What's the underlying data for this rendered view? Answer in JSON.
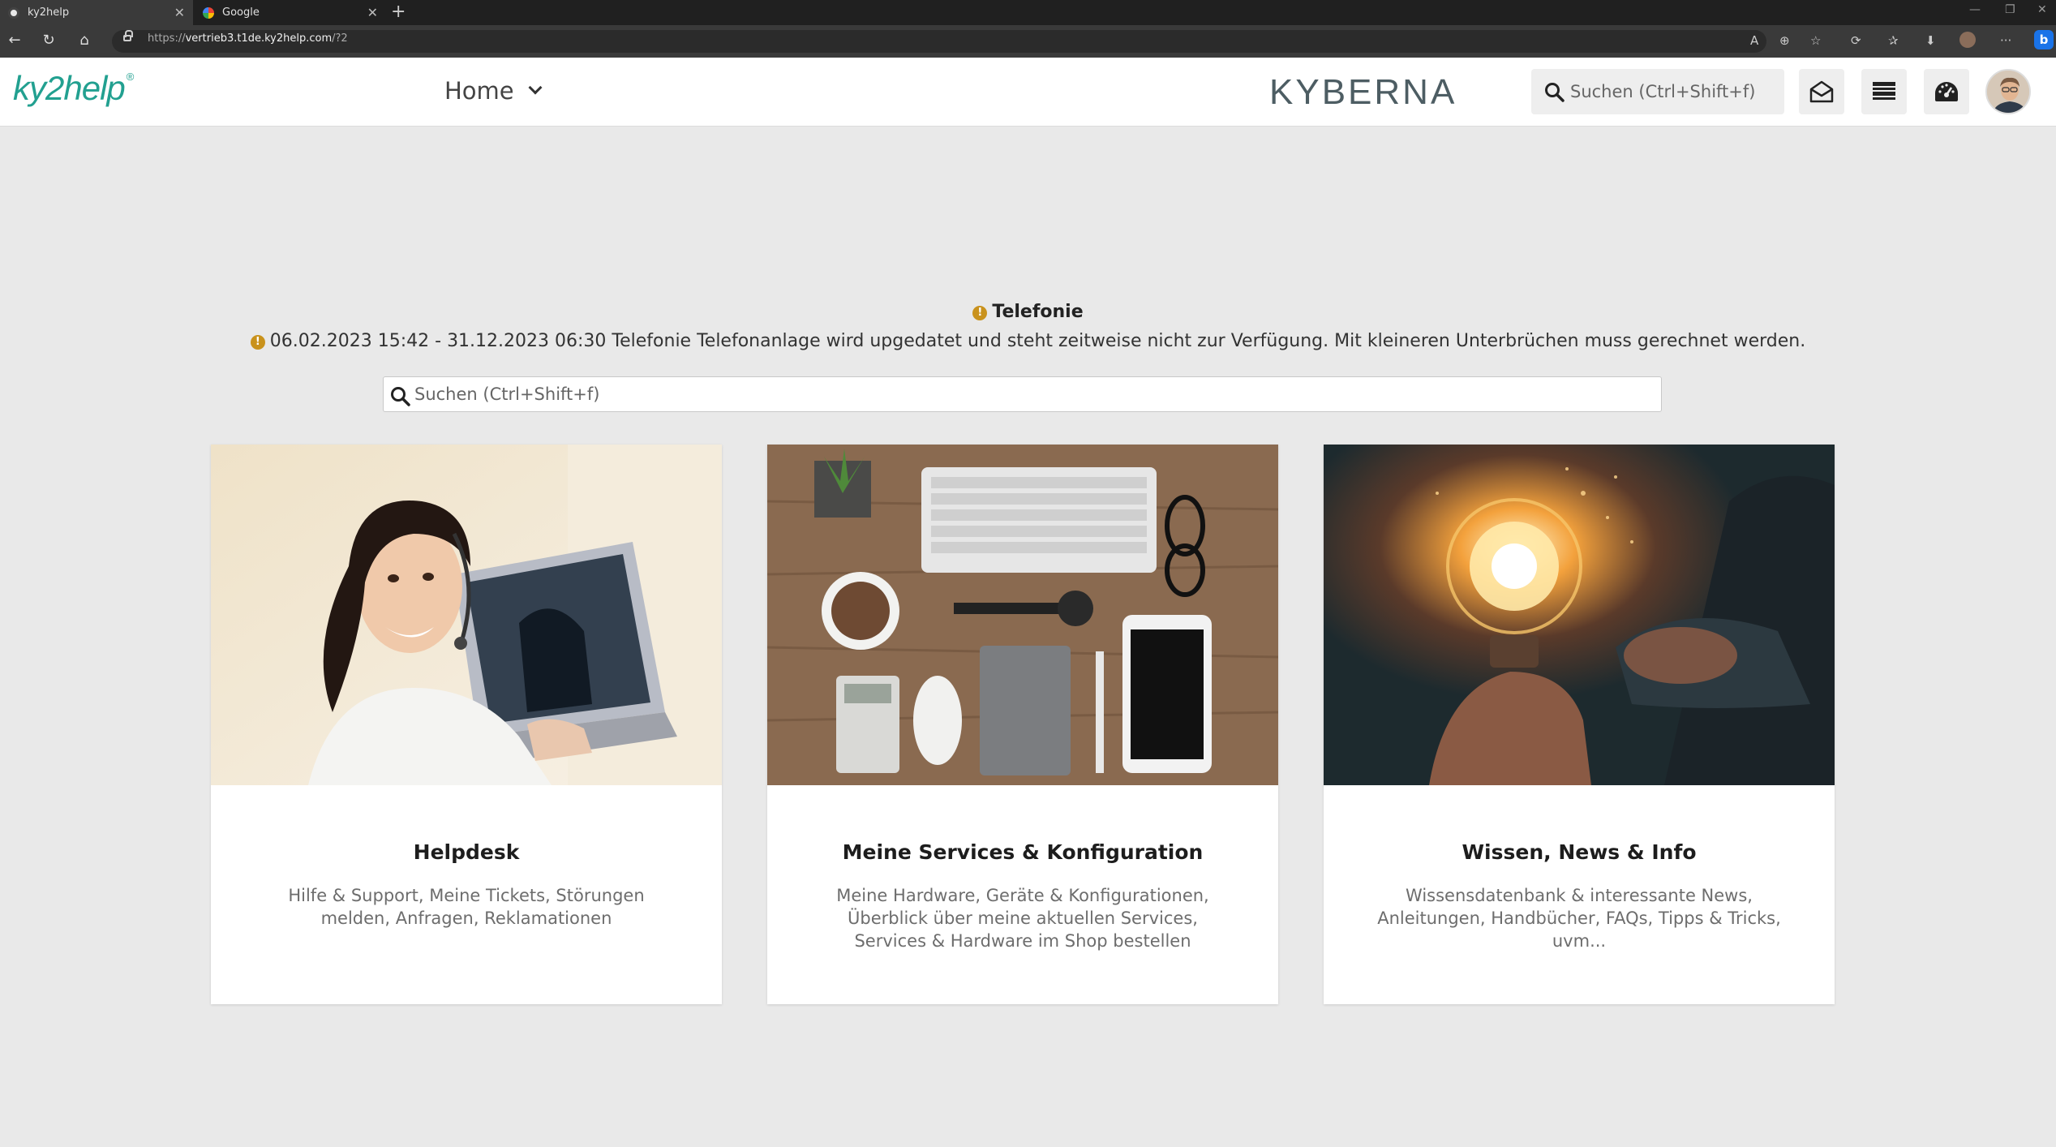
{
  "browser": {
    "tabs": [
      {
        "title": "ky2help"
      },
      {
        "title": "Google"
      }
    ],
    "url_prefix": "https://",
    "url_host": "vertrieb3.t1de.ky2help.com",
    "url_path": "/?2"
  },
  "header": {
    "logo_text": "ky2help",
    "logo_mark": "®",
    "nav_label": "Home",
    "brand_text": "KYBERNA",
    "search_placeholder": "Suchen (Ctrl+Shift+f)"
  },
  "notice": {
    "title": "Telefonie",
    "text": "06.02.2023 15:42 - 31.12.2023 06:30 Telefonie Telefonanlage wird upgedatet und steht zeitweise nicht zur Verfügung. Mit kleineren Unterbrüchen muss gerechnet werden.",
    "icon": "warning-icon",
    "color": "#c9921c"
  },
  "main_search": {
    "placeholder": "Suchen (Ctrl+Shift+f)"
  },
  "cards": [
    {
      "title": "Helpdesk",
      "description": "Hilfe & Support, Meine Tickets, Störungen melden, Anfragen, Reklamationen"
    },
    {
      "title": "Meine Services & Konfiguration",
      "description": "Meine Hardware, Geräte & Konfigurationen, Überblick über meine aktuellen Services, Services & Hardware im Shop bestellen"
    },
    {
      "title": "Wissen, News & Info",
      "description": "Wissensdatenbank & interessante News, Anleitungen, Handbücher, FAQs, Tipps & Tricks, uvm..."
    }
  ],
  "colors": {
    "accent": "#22a090",
    "brand": "#4d5d63",
    "background": "#e9e9e9"
  }
}
